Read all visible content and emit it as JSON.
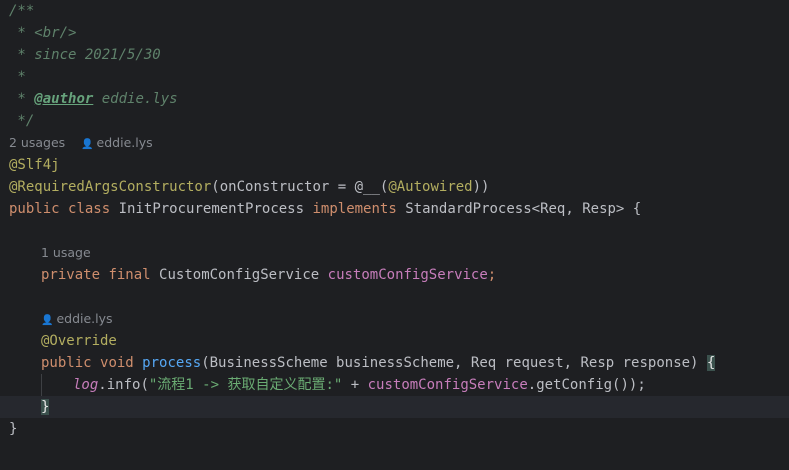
{
  "comment": {
    "open": "/**",
    "br": " * <br/>",
    "since": " * since 2021/5/30",
    "blank": " *",
    "author_prefix": " * ",
    "author_tag": "@author",
    "author_name": " eddie.lys",
    "close": " */"
  },
  "hints": {
    "class_usages": "2 usages",
    "class_author": "eddie.lys",
    "field_usages": "1 usage",
    "method_author": "eddie.lys",
    "person_glyph": "👤"
  },
  "code": {
    "ann_slf4j": "@Slf4j",
    "ann_rac": "@RequiredArgsConstructor",
    "rac_args_open": "(onConstructor = @__(",
    "ann_autowired": "@Autowired",
    "rac_args_close": "))",
    "kw_public": "public",
    "kw_class": "class",
    "class_name": "InitProcurementProcess",
    "kw_implements": "implements",
    "interface": "StandardProcess<Req, Resp> {",
    "kw_private": "private",
    "kw_final": "final",
    "field_type": "CustomConfigService",
    "field_name": "customConfigService",
    "semicolon": ";",
    "ann_override": "@Override",
    "kw_void": "void",
    "method_name": "process",
    "params": "(BusinessScheme businessScheme, Req request, Resp response) ",
    "open_brace": "{",
    "log_var": "log",
    "log_call": ".info(",
    "log_string": "\"流程1 -> 获取自定义配置:\"",
    "plus": " + ",
    "get_config": ".getConfig());",
    "close_brace": "}",
    "class_close": "}"
  }
}
